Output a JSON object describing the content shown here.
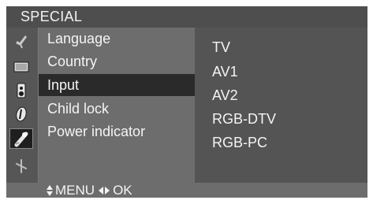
{
  "title": "SPECIAL",
  "side_icons": [
    {
      "name": "picture-icon",
      "selected": false
    },
    {
      "name": "screen-icon",
      "selected": false
    },
    {
      "name": "audio-icon",
      "selected": false
    },
    {
      "name": "time-icon",
      "selected": false
    },
    {
      "name": "special-icon",
      "selected": true
    },
    {
      "name": "settings-icon",
      "selected": false
    }
  ],
  "menu": {
    "items": [
      "Language",
      "Country",
      "Input",
      "Child lock",
      "Power indicator"
    ],
    "selected": "Input"
  },
  "submenu": {
    "items": [
      "TV",
      "AV1",
      "AV2",
      "RGB-DTV",
      "RGB-PC"
    ]
  },
  "footer": {
    "menu_label": "MENU",
    "ok_label": "OK",
    "icons": [
      "up-down-arrow-icon",
      "left-right-arrow-icon"
    ]
  }
}
